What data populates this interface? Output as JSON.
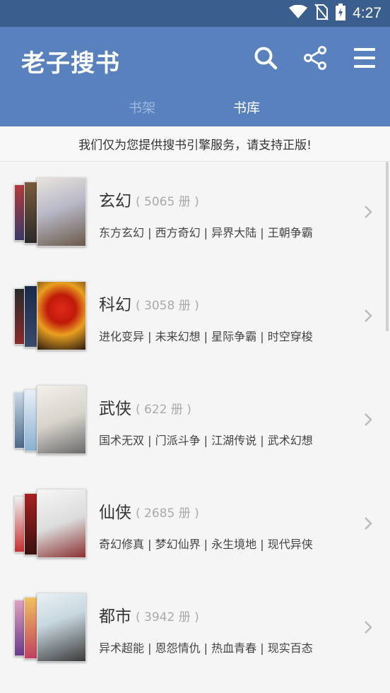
{
  "status": {
    "time": "4:27",
    "icons": [
      "wifi-icon",
      "no-sim-icon",
      "battery-charging-icon"
    ]
  },
  "app": {
    "title": "老子搜书",
    "actions": [
      "search-icon",
      "share-icon",
      "menu-icon"
    ]
  },
  "tabs": [
    {
      "label": "书架",
      "active": false
    },
    {
      "label": "书库",
      "active": true
    }
  ],
  "notice": "我们仅为您提供搜书引擎服务，请支持正版!",
  "categories": [
    {
      "name": "玄幻",
      "count": "( 5065 册 )",
      "tags": "东方玄幻 | 西方奇幻 | 异界大陆 | 王朝争霸"
    },
    {
      "name": "科幻",
      "count": "( 3058 册 )",
      "tags": "进化变异 | 未来幻想 | 星际争霸 | 时空穿梭"
    },
    {
      "name": "武侠",
      "count": "( 622 册 )",
      "tags": "国术无双 | 门派斗争 | 江湖传说 | 武术幻想"
    },
    {
      "name": "仙侠",
      "count": "( 2685 册 )",
      "tags": "奇幻修真 | 梦幻仙界 | 永生境地 | 现代异侠"
    },
    {
      "name": "都市",
      "count": "( 3942 册 )",
      "tags": "异术超能 | 恩怨情仇 | 热血青春 | 现实百态"
    }
  ],
  "colors": {
    "status_bar": "#3a5f8f",
    "app_bar": "#5881be",
    "inactive_tab": "#9fb8dc"
  }
}
